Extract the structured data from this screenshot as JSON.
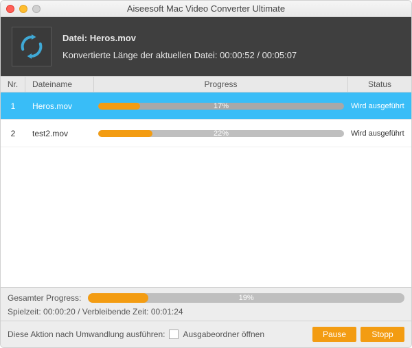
{
  "window": {
    "title": "Aiseesoft Mac Video Converter Ultimate"
  },
  "header": {
    "file_label": "Datei:",
    "file_name": "Heros.mov",
    "converted_label": "Konvertierte Länge der aktuellen Datei:",
    "converted_current": "00:00:52",
    "converted_total": "00:05:07"
  },
  "columns": {
    "nr": "Nr.",
    "name": "Dateiname",
    "progress": "Progress",
    "status": "Status"
  },
  "rows": [
    {
      "nr": "1",
      "name": "Heros.mov",
      "percent": 17,
      "percent_label": "17%",
      "status": "Wird ausgeführt",
      "selected": true
    },
    {
      "nr": "2",
      "name": "test2.mov",
      "percent": 22,
      "percent_label": "22%",
      "status": "Wird ausgeführt",
      "selected": false
    }
  ],
  "overall": {
    "label": "Gesamter Progress:",
    "percent": 19,
    "percent_label": "19%"
  },
  "timing": {
    "elapsed_label": "Spielzeit:",
    "elapsed": "00:00:20",
    "remaining_label": "Verbleibende Zeit:",
    "remaining": "00:01:24"
  },
  "actions": {
    "after_label": "Diese Aktion nach Umwandlung ausführen:",
    "open_folder_label": "Ausgabeordner öffnen",
    "pause": "Pause",
    "stop": "Stopp"
  },
  "colors": {
    "accent": "#f39c12",
    "selection": "#39bdf7"
  }
}
